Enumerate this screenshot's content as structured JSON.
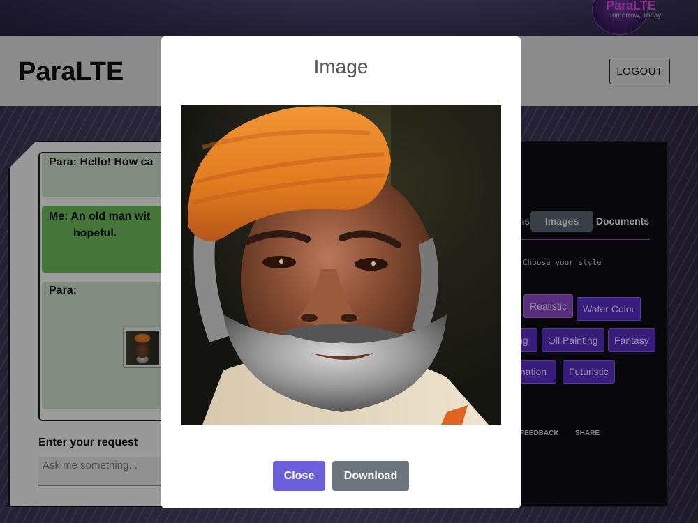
{
  "brand": {
    "name": "ParaLTE",
    "tagline": "Tomorrow, Today"
  },
  "header": {
    "title": "ParaLTE",
    "logout_label": "LOGOUT"
  },
  "chat": {
    "messages": [
      {
        "text": "Para: Hello! How ca"
      },
      {
        "line1": "Me: An old man wit",
        "line2": "hopeful."
      },
      {
        "text": "Para:"
      }
    ],
    "request_label": "Enter your request",
    "request_placeholder": "Ask me something..."
  },
  "side_panel": {
    "tabs": [
      "ns",
      "Images",
      "Documents"
    ],
    "active_tab": "Images",
    "style_hint": "Choose your style",
    "styles": [
      "Realistic",
      "Water Color",
      "ng",
      "Oil Painting",
      "Fantasy",
      "mation",
      "Futuristic"
    ],
    "selected_style": "Realistic",
    "footer_links": [
      "FEEDBACK",
      "SHARE"
    ]
  },
  "modal": {
    "title": "Image",
    "image_icon": "generated-portrait-image",
    "close_label": "Close",
    "download_label": "Download"
  },
  "colors": {
    "close_button": "#6b5fdb",
    "download_button": "#6c757d",
    "style_chip": "#5a2ec6",
    "style_chip_selected": "#8e48c6",
    "message_me": "#6dbb5c",
    "message_para": "#c8dcc8"
  }
}
